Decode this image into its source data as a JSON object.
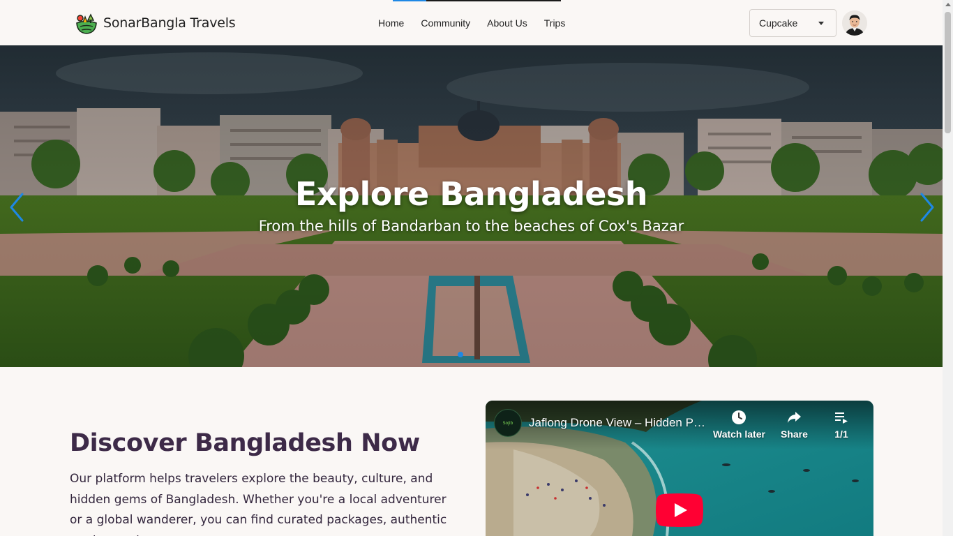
{
  "navbar": {
    "brand": "SonarBangla Travels",
    "links": [
      "Home",
      "Community",
      "About Us",
      "Trips"
    ],
    "active_link": "Home",
    "theme_select": {
      "value": "Cupcake"
    }
  },
  "hero": {
    "title": "Explore Bangladesh",
    "subtitle": "From the hills of Bandarban to the beaches of Cox's Bazar",
    "slide_count": 1,
    "active_slide": 1
  },
  "discover": {
    "title": "Discover Bangladesh Now",
    "text": "Our platform helps travelers explore the beauty, culture, and hidden gems of Bangladesh. Whether you're a local adventurer or a global wanderer, you can find curated packages, authentic stories, and"
  },
  "video": {
    "title": "Jaflong Drone View – Hidden Paradise",
    "channel_badge": "Sojib",
    "watch_later": "Watch later",
    "share": "Share",
    "playlist_count": "1/1"
  },
  "colors": {
    "accent": "#1e88e5",
    "heading": "#3d2a48",
    "background": "#faf7f5",
    "youtube_red": "#ff0033"
  },
  "icons": [
    "brand-logo-icon",
    "chevron-down-icon",
    "chevron-left-icon",
    "chevron-right-icon",
    "clock-icon",
    "share-icon",
    "playlist-icon",
    "play-icon"
  ]
}
